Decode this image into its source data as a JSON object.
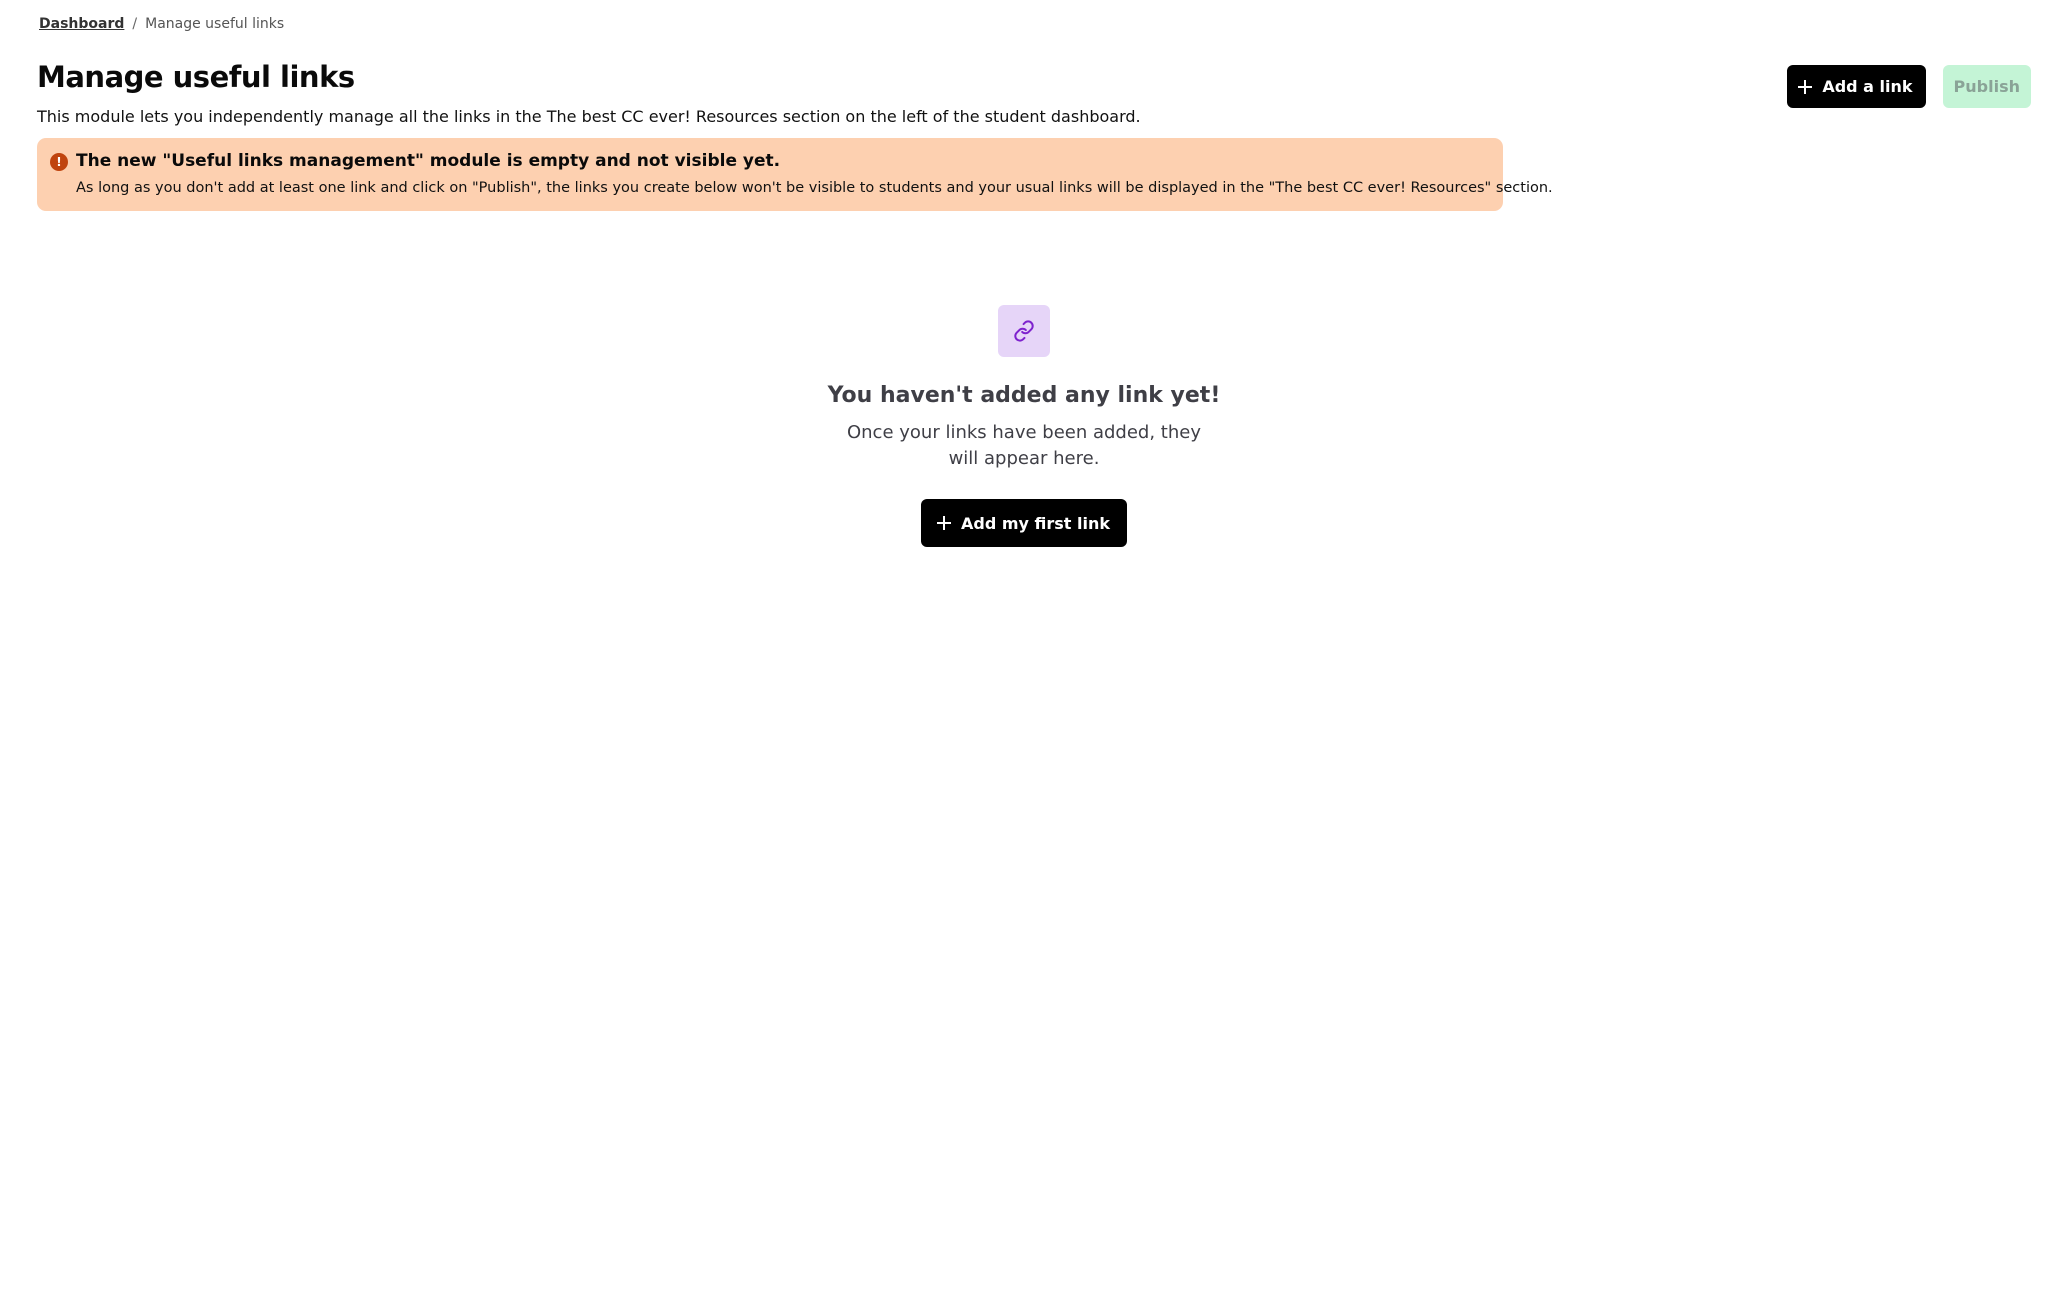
{
  "breadcrumb": {
    "root_label": "Dashboard",
    "separator": "/",
    "current_label": "Manage useful links"
  },
  "header": {
    "title": "Manage useful links",
    "description": "This module lets you independently manage all the links in the The best CC ever! Resources section on the left of the student dashboard.",
    "add_link_label": "Add a link",
    "publish_label": "Publish",
    "publish_disabled": true
  },
  "alert": {
    "icon": "exclamation-circle-icon",
    "icon_glyph": "!",
    "title": "The new \"Useful links management\" module is empty and not visible yet.",
    "body": "As long as you don't add at least one link and click on \"Publish\", the links you create below won't be visible to students and your usual links will be displayed in the \"The best CC ever! Resources\" section."
  },
  "empty_state": {
    "icon": "link-icon",
    "title": "You haven't added any link yet!",
    "text": "Once your links have been added, they will appear here.",
    "button_label": "Add my first link"
  },
  "colors": {
    "primary_button": "#000000",
    "publish_button_bg": "#c4f4d6",
    "publish_button_text": "#8aa397",
    "alert_bg": "#fdd0b0",
    "alert_icon": "#c0440e",
    "empty_icon_bg": "#e6d5f8",
    "empty_icon_stroke": "#7e22ce"
  }
}
